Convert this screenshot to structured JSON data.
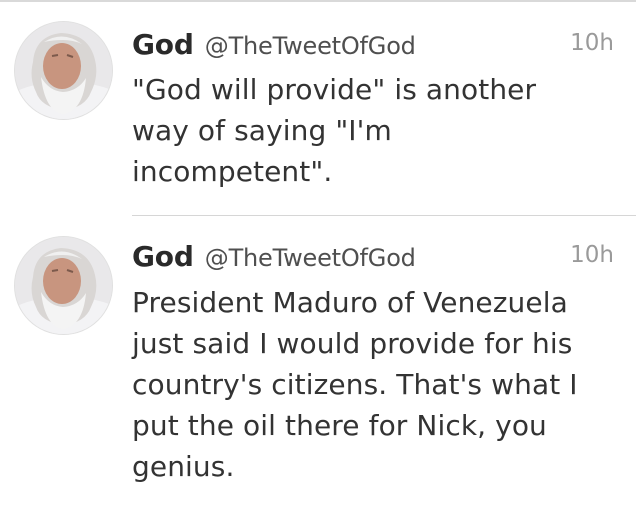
{
  "tweets": [
    {
      "name": "God",
      "handle": "@TheTweetOfGod",
      "time": "10h",
      "text": "\"God will provide\" is another\nway of saying \"I'm\nincompetent\"."
    },
    {
      "name": "God",
      "handle": "@TheTweetOfGod",
      "time": "10h",
      "text": "President Maduro of Venezuela\njust said I would provide for his\ncountry's citizens. That's what I\nput the oil there for Nick, you\ngenius."
    }
  ],
  "colors": {
    "divider": "#d6d6d6",
    "text": "#333333",
    "timestamp": "#9a9a9a"
  }
}
